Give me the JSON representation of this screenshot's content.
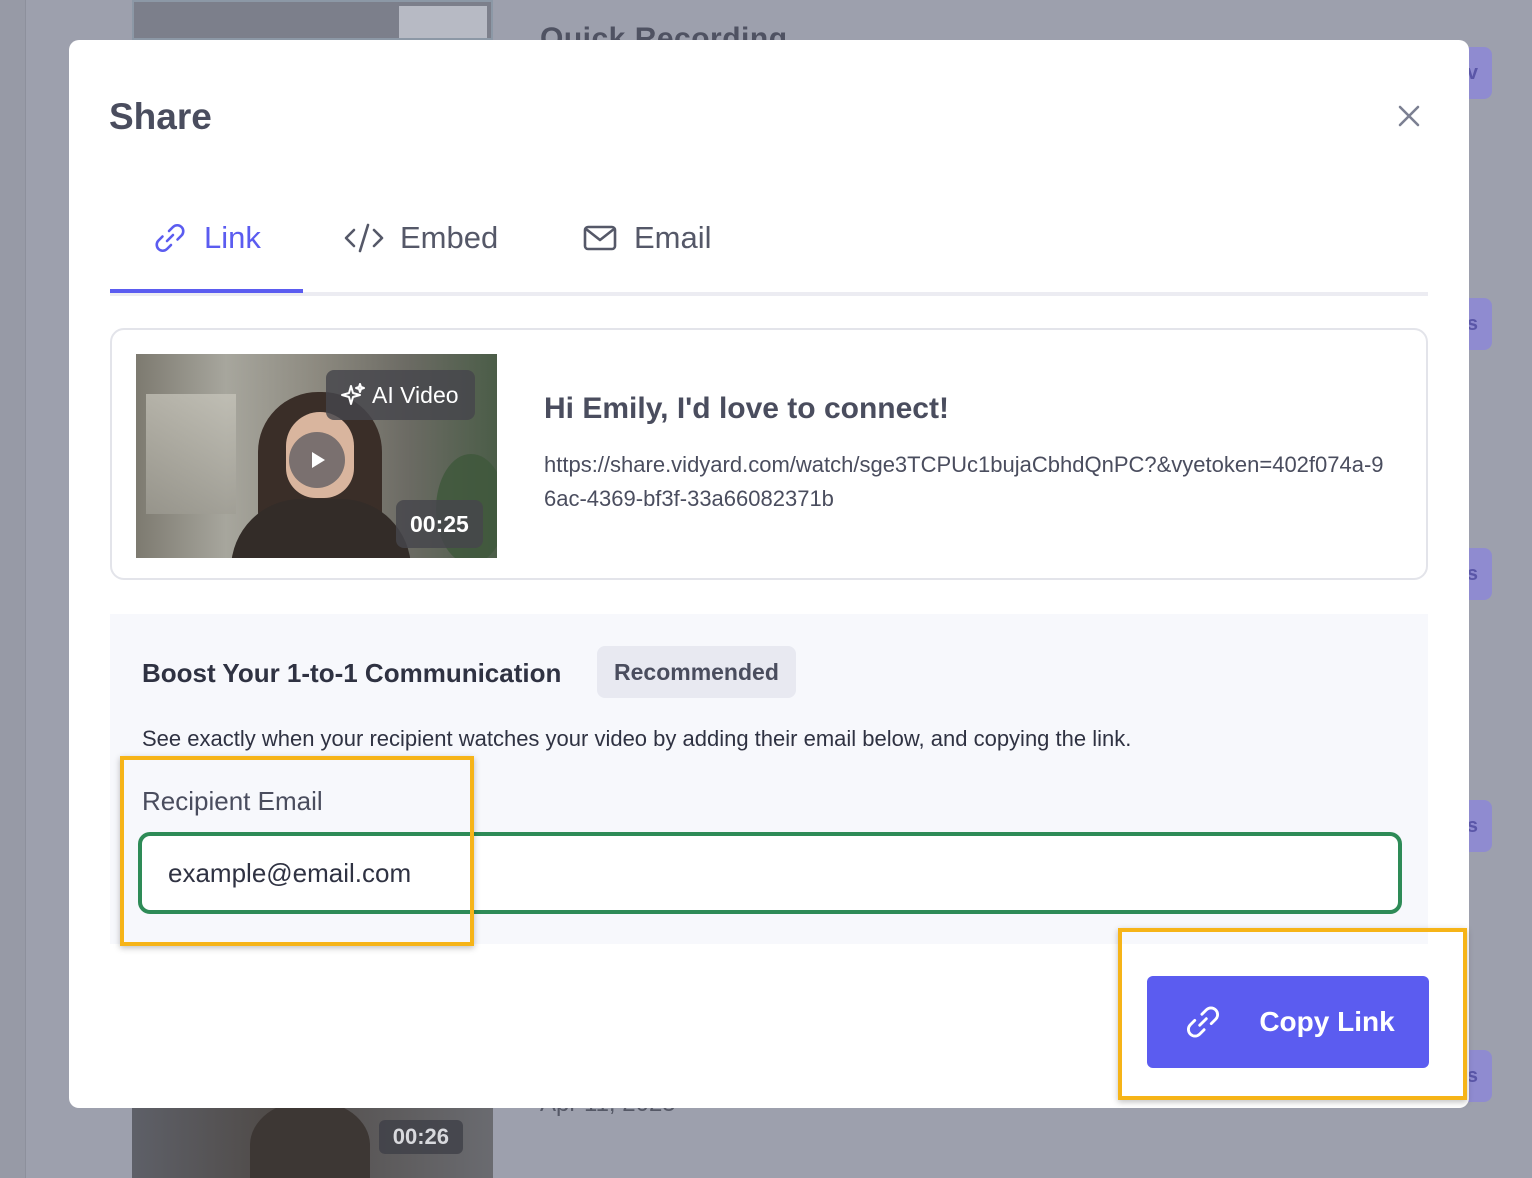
{
  "background": {
    "top_title": "Quick Recording",
    "bottom_duration": "00:26",
    "bottom_date": "Apr 11, 2025",
    "pill_letters": [
      "v",
      "s",
      "s",
      "s",
      "s"
    ]
  },
  "modal": {
    "title": "Share",
    "close_icon": "close-icon"
  },
  "tabs": [
    {
      "label": "Link",
      "icon": "link-icon",
      "active": true
    },
    {
      "label": "Embed",
      "icon": "code-icon",
      "active": false
    },
    {
      "label": "Email",
      "icon": "mail-icon",
      "active": false
    }
  ],
  "video": {
    "badge": "AI Video",
    "duration": "00:25",
    "title": "Hi Emily, I'd love to connect!",
    "url": "https://share.vidyard.com/watch/sge3TCPUc1bujaCbhdQnPC?&vyetoken=402f074a-96ac-4369-bf3f-33a66082371b"
  },
  "boost": {
    "title": "Boost Your 1-to-1 Communication",
    "badge": "Recommended",
    "description": "See exactly when your recipient watches your video by adding their email below, and copying the link.",
    "email_label": "Recipient Email",
    "email_value": "example@email.com"
  },
  "actions": {
    "copy_link_label": "Copy Link"
  },
  "colors": {
    "accent": "#5b5cf0",
    "input_focus_border": "#2e8b57",
    "highlight": "#f6b418",
    "text_primary": "#4a4d5e"
  }
}
